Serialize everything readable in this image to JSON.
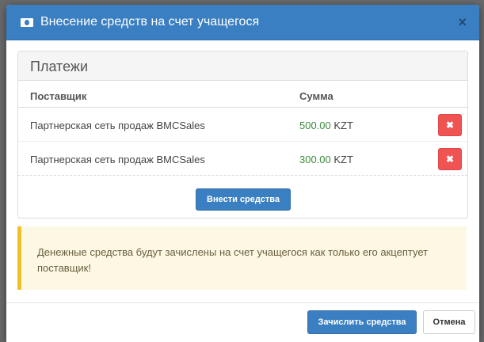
{
  "modal": {
    "title": "Внесение средств на счет учащегося",
    "close_glyph": "×"
  },
  "payments": {
    "heading": "Платежи",
    "columns": {
      "provider": "Поставщик",
      "amount": "Сумма"
    },
    "rows": [
      {
        "provider": "Партнерская сеть продаж BMCSales",
        "amount": "500.00",
        "currency": "KZT"
      },
      {
        "provider": "Партнерская сеть продаж BMCSales",
        "amount": "300.00",
        "currency": "KZT"
      }
    ],
    "delete_glyph": "✖",
    "add_button": "Внести средства"
  },
  "alert": {
    "text": "Денежные средства будут зачислены на счет учащегося как только его акцептует поставщик!"
  },
  "footer": {
    "submit_button": "Зачислить средства",
    "cancel_button": "Отмена"
  },
  "colors": {
    "primary": "#3a7fc1",
    "danger": "#ef5453",
    "success_text": "#3c8b3c",
    "warning_border": "#f0c02a"
  },
  "icons": {
    "title_icon": "money-icon"
  }
}
